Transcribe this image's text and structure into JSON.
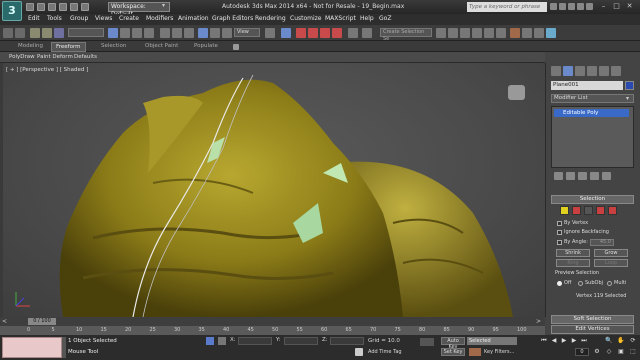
{
  "titlebar": {
    "workspace": "Workspace: Default",
    "title": "Autodesk 3ds Max  2014 x64   - Not for Resale -   19_Begin.max",
    "search_placeholder": "Type a keyword or phrase"
  },
  "menu": [
    "Edit",
    "Tools",
    "Group",
    "Views",
    "Create",
    "Modifiers",
    "Animation",
    "Graph Editors",
    "Rendering",
    "Customize",
    "MAXScript",
    "Help",
    "GoZ"
  ],
  "toolbar": {
    "view_dropdown": "View",
    "selection_set": "Create Selection Se"
  },
  "ribbon": {
    "tabs": [
      "Modeling",
      "Freeform",
      "Selection",
      "Object Paint",
      "Populate"
    ],
    "active_tab": "Freeform",
    "subtabs": [
      "PolyDraw",
      "Paint Deform",
      "Defaults"
    ]
  },
  "viewport": {
    "label": "[ + ] [Perspective ] [ Shaded ]"
  },
  "command_panel": {
    "object_name": "Plane001",
    "object_color": "#2a4ab0",
    "modifier_list": "Modifier List",
    "stack": [
      "Editable Poly"
    ],
    "selection_rollout": {
      "title": "Selection",
      "by_vertex": "By Vertex",
      "ignore_backfacing": "Ignore Backfacing",
      "by_angle": "By Angle:",
      "by_angle_value": "45.0",
      "shrink": "Shrink",
      "grow": "Grow",
      "ring": "Ring",
      "loop": "Loop",
      "preview_selection": "Preview Selection",
      "preview_off": "Off",
      "preview_subobj": "SubObj",
      "preview_multi": "Multi",
      "status": "Vertex 119 Selected"
    },
    "soft_selection": "Soft Selection",
    "edit_vertices": "Edit Vertices"
  },
  "timeline": {
    "slider": "0 / 100",
    "ticks": [
      "0",
      "5",
      "10",
      "15",
      "20",
      "25",
      "30",
      "35",
      "40",
      "45",
      "50",
      "55",
      "60",
      "65",
      "70",
      "75",
      "80",
      "85",
      "90",
      "95",
      "100"
    ]
  },
  "status": {
    "selection": "1 Object Selected",
    "prompt": "Mouse Tool",
    "x_label": "X:",
    "y_label": "Y:",
    "z_label": "Z:",
    "grid": "Grid = 10.0",
    "add_time_tag": "Add Time Tag",
    "auto_key": "Auto Key",
    "set_key": "Set Key",
    "selected_dd": "Selected",
    "key_filters": "Key Filters...",
    "frame": "0"
  },
  "colors": {
    "accent": "#3a6ac8",
    "model": "#a09020"
  }
}
